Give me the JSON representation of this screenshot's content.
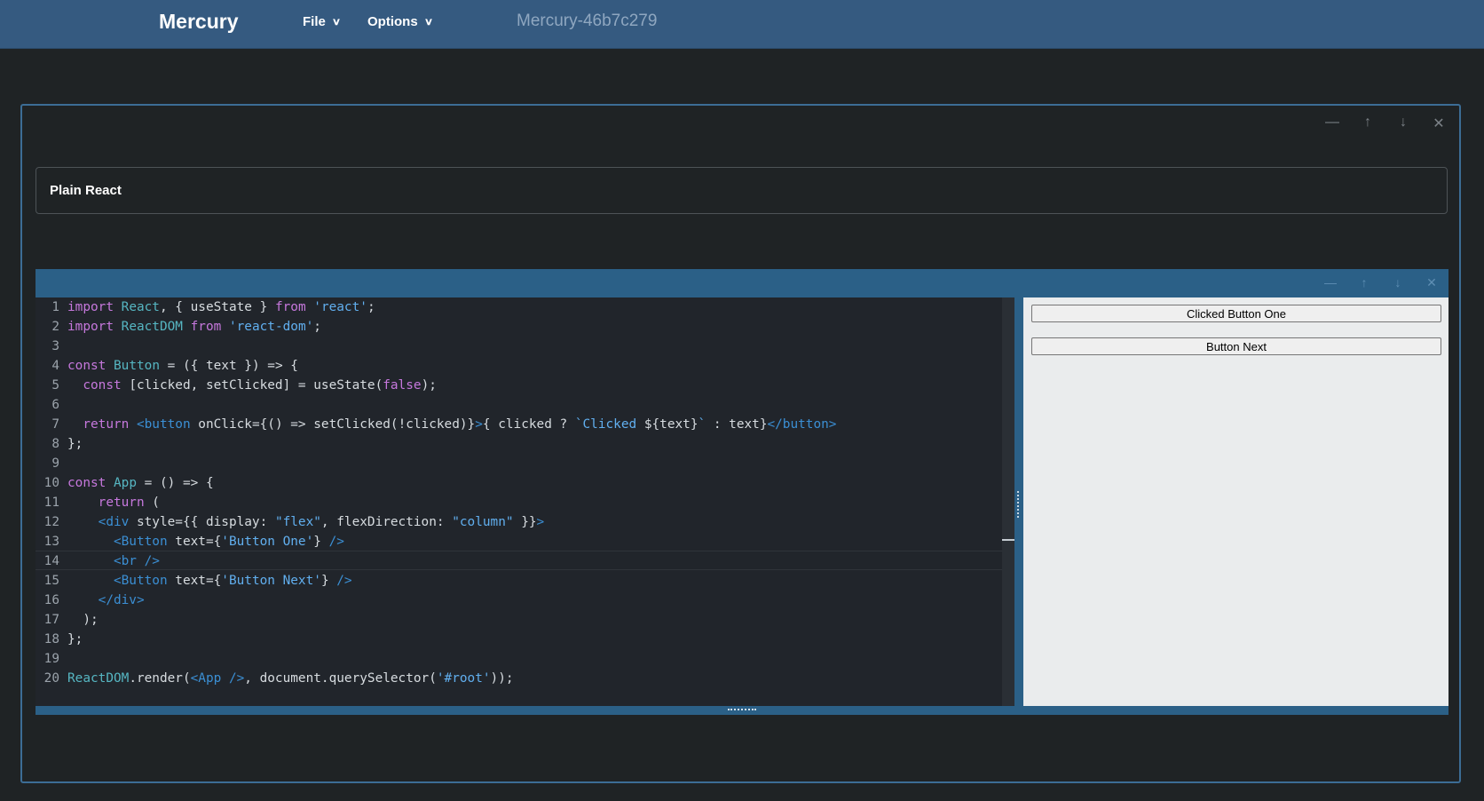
{
  "nav": {
    "brand": "Mercury",
    "file_label": "File",
    "options_label": "Options",
    "notebook_title": "Mercury-46b7c279"
  },
  "markdown_cell": {
    "text": "Plain React"
  },
  "cell_controls": {
    "minimize": "—",
    "move_up": "↑",
    "move_down": "↓",
    "close": "✕"
  },
  "code": {
    "line_numbers": [
      "1",
      "2",
      "3",
      "4",
      "5",
      "6",
      "7",
      "8",
      "9",
      "10",
      "11",
      "12",
      "13",
      "14",
      "15",
      "16",
      "17",
      "18",
      "19",
      "20"
    ]
  },
  "preview": {
    "button_one_label": "Clicked Button One",
    "button_next_label": "Button Next"
  },
  "icons": {
    "file_chevron": "chevron-down-icon",
    "options_chevron": "chevron-down-icon"
  },
  "colors": {
    "nav_bg": "#355a80",
    "page_bg": "#1f2325",
    "cell_border": "#3c6d95",
    "code_cell_bg": "#2b6087",
    "editor_bg": "#21252b",
    "keyword": "#c678dd",
    "identifier": "#56b6c2",
    "string": "#61afef"
  }
}
